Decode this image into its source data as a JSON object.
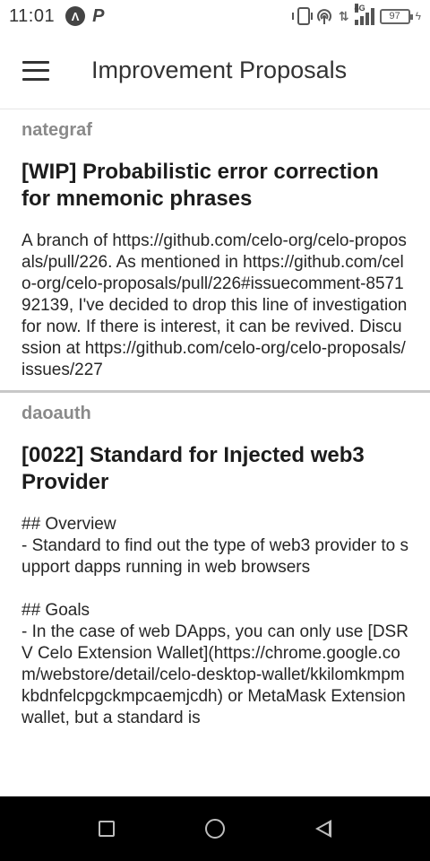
{
  "status_bar": {
    "time": "11:01",
    "network_type": "4G",
    "battery_level": "97",
    "icons": [
      "assistant-icon",
      "p-icon",
      "vibrate-icon",
      "hotspot-icon",
      "data-transfer-icon",
      "signal-icon",
      "battery-icon",
      "charging-bolt-icon"
    ]
  },
  "app_bar": {
    "title": "Improvement Proposals",
    "menu_icon": "hamburger-menu-icon"
  },
  "proposals": [
    {
      "author": "nategraf",
      "title": "[WIP] Probabilistic error correction for mnemonic phrases",
      "body": "A branch of https://github.com/celo-org/celo-proposals/pull/226. As mentioned in https://github.com/celo-org/celo-proposals/pull/226#issuecomment-857192139, I've decided to drop this line of investigation for now. If there is interest, it can be revived. Discussion at https://github.com/celo-org/celo-proposals/issues/227"
    },
    {
      "author": "daoauth",
      "title": "[0022] Standard for Injected web3 Provider",
      "body": "## Overview\n- Standard to find out the type of web3 provider to support dapps running in web browsers\n\n## Goals\n- In the case of web DApps, you can only use [DSRV Celo Extension Wallet](https://chrome.google.com/webstore/detail/celo-desktop-wallet/kkilomkmpmkbdnfelcpgckmpcaemjcdh) or MetaMask Extension wallet, but a standard is"
    }
  ],
  "nav_bar": {
    "buttons": [
      "recent-apps-button",
      "home-button",
      "back-button"
    ]
  }
}
